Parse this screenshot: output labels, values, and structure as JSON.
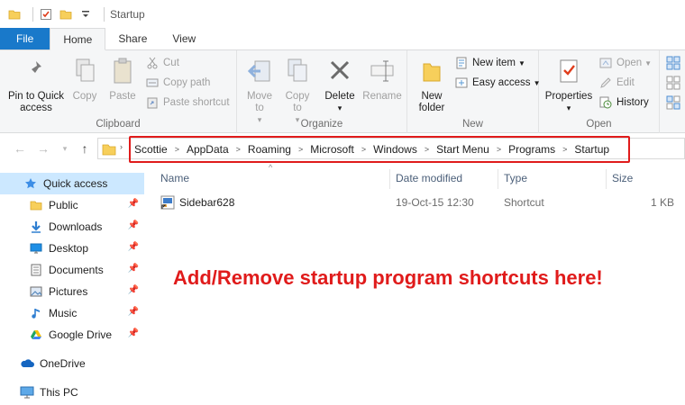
{
  "window": {
    "title": "Startup"
  },
  "ribbon_tabs": [
    "File",
    "Home",
    "Share",
    "View"
  ],
  "ribbon": {
    "clipboard": {
      "label": "Clipboard",
      "pin": "Pin to Quick access",
      "copy": "Copy",
      "paste": "Paste",
      "cut": "Cut",
      "copy_path": "Copy path",
      "paste_shortcut": "Paste shortcut"
    },
    "organize": {
      "label": "Organize",
      "move_to": "Move to",
      "copy_to": "Copy to",
      "delete": "Delete",
      "rename": "Rename"
    },
    "new": {
      "label": "New",
      "new_folder": "New folder",
      "new_item": "New item",
      "easy_access": "Easy access"
    },
    "open": {
      "label": "Open",
      "properties": "Properties",
      "open": "Open",
      "edit": "Edit",
      "history": "History"
    }
  },
  "address_bar": {
    "breadcrumbs": [
      "Scottie",
      "AppData",
      "Roaming",
      "Microsoft",
      "Windows",
      "Start Menu",
      "Programs",
      "Startup"
    ]
  },
  "nav_pane": {
    "quick_access": "Quick access",
    "items": [
      {
        "label": "Public",
        "icon": "folder-icon",
        "pinned": true
      },
      {
        "label": "Downloads",
        "icon": "download-icon",
        "pinned": true
      },
      {
        "label": "Desktop",
        "icon": "desktop-icon",
        "pinned": true
      },
      {
        "label": "Documents",
        "icon": "documents-icon",
        "pinned": true
      },
      {
        "label": "Pictures",
        "icon": "pictures-icon",
        "pinned": true
      },
      {
        "label": "Music",
        "icon": "music-icon",
        "pinned": true
      },
      {
        "label": "Google Drive",
        "icon": "google-drive-icon",
        "pinned": true
      }
    ],
    "onedrive": "OneDrive",
    "this_pc": "This PC"
  },
  "file_list": {
    "columns": [
      "Name",
      "Date modified",
      "Type",
      "Size"
    ],
    "rows": [
      {
        "name": "Sidebar628",
        "date_modified": "19-Oct-15 12:30",
        "type": "Shortcut",
        "size": "1 KB"
      }
    ]
  },
  "annotation": "Add/Remove startup program shortcuts here!",
  "colors": {
    "accent": "#1979ca",
    "highlight": "#e01b1b",
    "selection": "#cce8ff"
  }
}
